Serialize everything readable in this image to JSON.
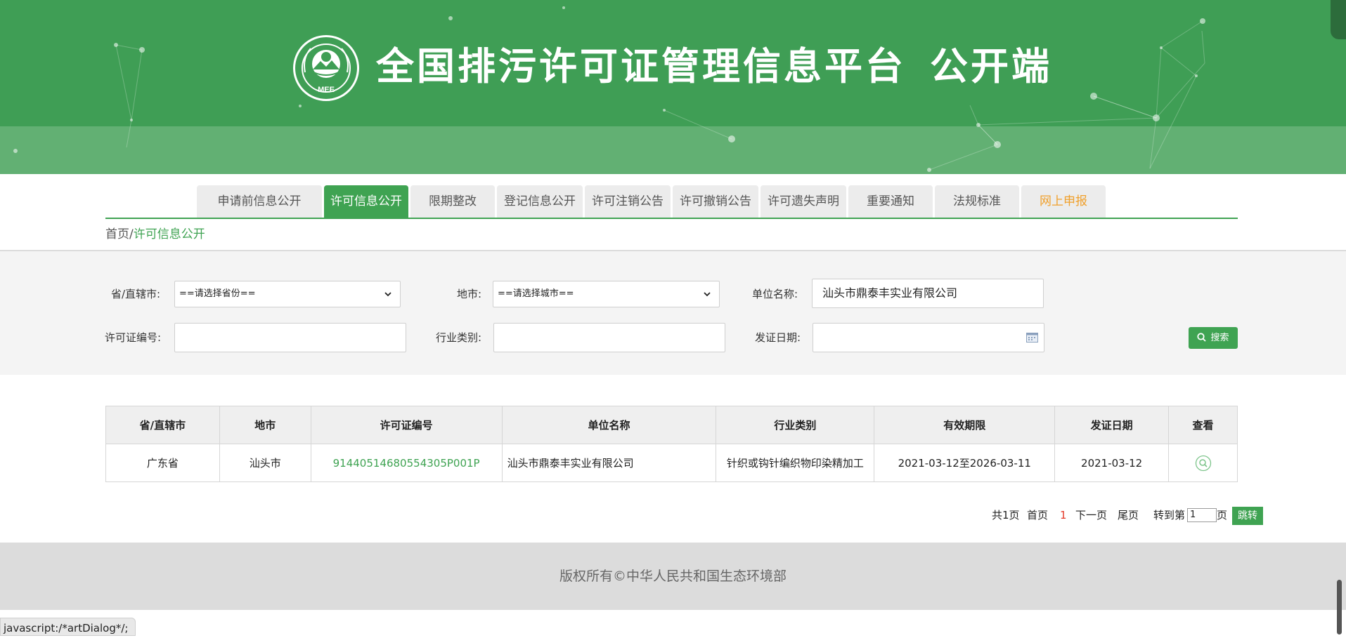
{
  "header": {
    "title": "全国排污许可证管理信息平台",
    "subtitle": "公开端",
    "logo_text": "MEE"
  },
  "nav": {
    "items": [
      {
        "label": "申请前信息公开",
        "state": "normal"
      },
      {
        "label": "许可信息公开",
        "state": "active"
      },
      {
        "label": "限期整改",
        "state": "normal"
      },
      {
        "label": "登记信息公开",
        "state": "normal"
      },
      {
        "label": "许可注销公告",
        "state": "normal"
      },
      {
        "label": "许可撤销公告",
        "state": "normal"
      },
      {
        "label": "许可遗失声明",
        "state": "normal"
      },
      {
        "label": "重要通知",
        "state": "normal"
      },
      {
        "label": "法规标准",
        "state": "normal"
      },
      {
        "label": "网上申报",
        "state": "highlight"
      }
    ]
  },
  "breadcrumb": {
    "home": "首页",
    "separator": "/",
    "current": "许可信息公开"
  },
  "search": {
    "province_label": "省/直辖市:",
    "province_value": "==请选择省份==",
    "city_label": "地市:",
    "city_value": "==请选择城市==",
    "unit_label": "单位名称:",
    "unit_value": "汕头市鼎泰丰实业有限公司",
    "license_label": "许可证编号:",
    "license_value": "",
    "industry_label": "行业类别:",
    "industry_value": "",
    "date_label": "发证日期:",
    "date_value": "",
    "button_label": "搜索"
  },
  "table": {
    "headers": [
      "省/直辖市",
      "地市",
      "许可证编号",
      "单位名称",
      "行业类别",
      "有效期限",
      "发证日期",
      "查看"
    ],
    "rows": [
      {
        "province": "广东省",
        "city": "汕头市",
        "license_no": "91440514680554305P001P",
        "unit": "汕头市鼎泰丰实业有限公司",
        "industry": "针织或钩针编织物印染精加工",
        "validity": "2021-03-12至2026-03-11",
        "issue_date": "2021-03-12",
        "view_icon": "search-icon"
      }
    ]
  },
  "pagination": {
    "total": "共1页",
    "first": "首页",
    "current": "1",
    "next": "下一页",
    "last": "尾页",
    "goto_prefix": "转到第",
    "goto_value": "1",
    "goto_suffix": "页",
    "jump_button": "跳转"
  },
  "footer": {
    "copyright": "版权所有©中华人民共和国生态环境部"
  },
  "statusbar": {
    "text": "javascript:/*artDialog*/;"
  },
  "colors": {
    "header_green": "#3f9e55",
    "accent_green": "#3fa352",
    "highlight_orange": "#f0a02c",
    "current_page_red": "#e43b2a"
  }
}
